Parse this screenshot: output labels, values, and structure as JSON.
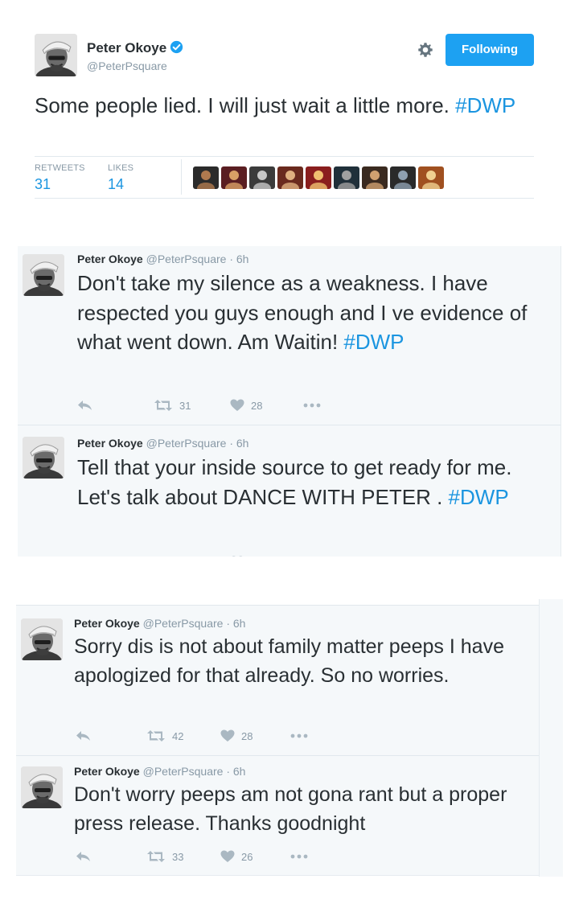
{
  "main_tweet": {
    "name": "Peter Okoye",
    "handle": "@PeterPsquare",
    "follow_label": "Following",
    "text": "Some people lied. I will just wait a little more. ",
    "hashtag": "#DWP",
    "retweets_label": "RETWEETS",
    "retweets": "31",
    "likes_label": "LIKES",
    "likes": "14",
    "liker_count": 9
  },
  "tweets": [
    {
      "name": "Peter Okoye",
      "handle": "@PeterPsquare",
      "time": "· 6h",
      "text": "Don't take my silence as a weakness. I have respected you guys enough and I ve evidence of what went down. Am Waitin! ",
      "hashtag": "#DWP",
      "retweets": "31",
      "likes": "28"
    },
    {
      "name": "Peter Okoye",
      "handle": "@PeterPsquare",
      "time": "· 6h",
      "text": "Tell that your inside source to get ready for me. Let's talk about DANCE WITH PETER . ",
      "hashtag": "#DWP",
      "retweets": "",
      "likes": ""
    },
    {
      "name": "Peter Okoye",
      "handle": "@PeterPsquare",
      "time": "· 6h",
      "text": "Sorry dis is not about family matter peeps I have apologized for that already. So no worries.",
      "hashtag": "",
      "retweets": "42",
      "likes": "28"
    },
    {
      "name": "Peter Okoye",
      "handle": "@PeterPsquare",
      "time": "· 6h",
      "text": "Don't worry peeps am not gona rant but a proper press release. Thanks goodnight",
      "hashtag": "",
      "retweets": "33",
      "likes": "26"
    }
  ],
  "colors": {
    "link": "#1b95e0",
    "follow_button": "#1da1f2",
    "muted": "#8899a6",
    "text": "#292f33",
    "card_background": "#f5f8fa"
  },
  "icons": [
    "verified-badge-icon",
    "gear-icon",
    "reply-icon",
    "retweet-icon",
    "like-icon",
    "more-icon"
  ]
}
